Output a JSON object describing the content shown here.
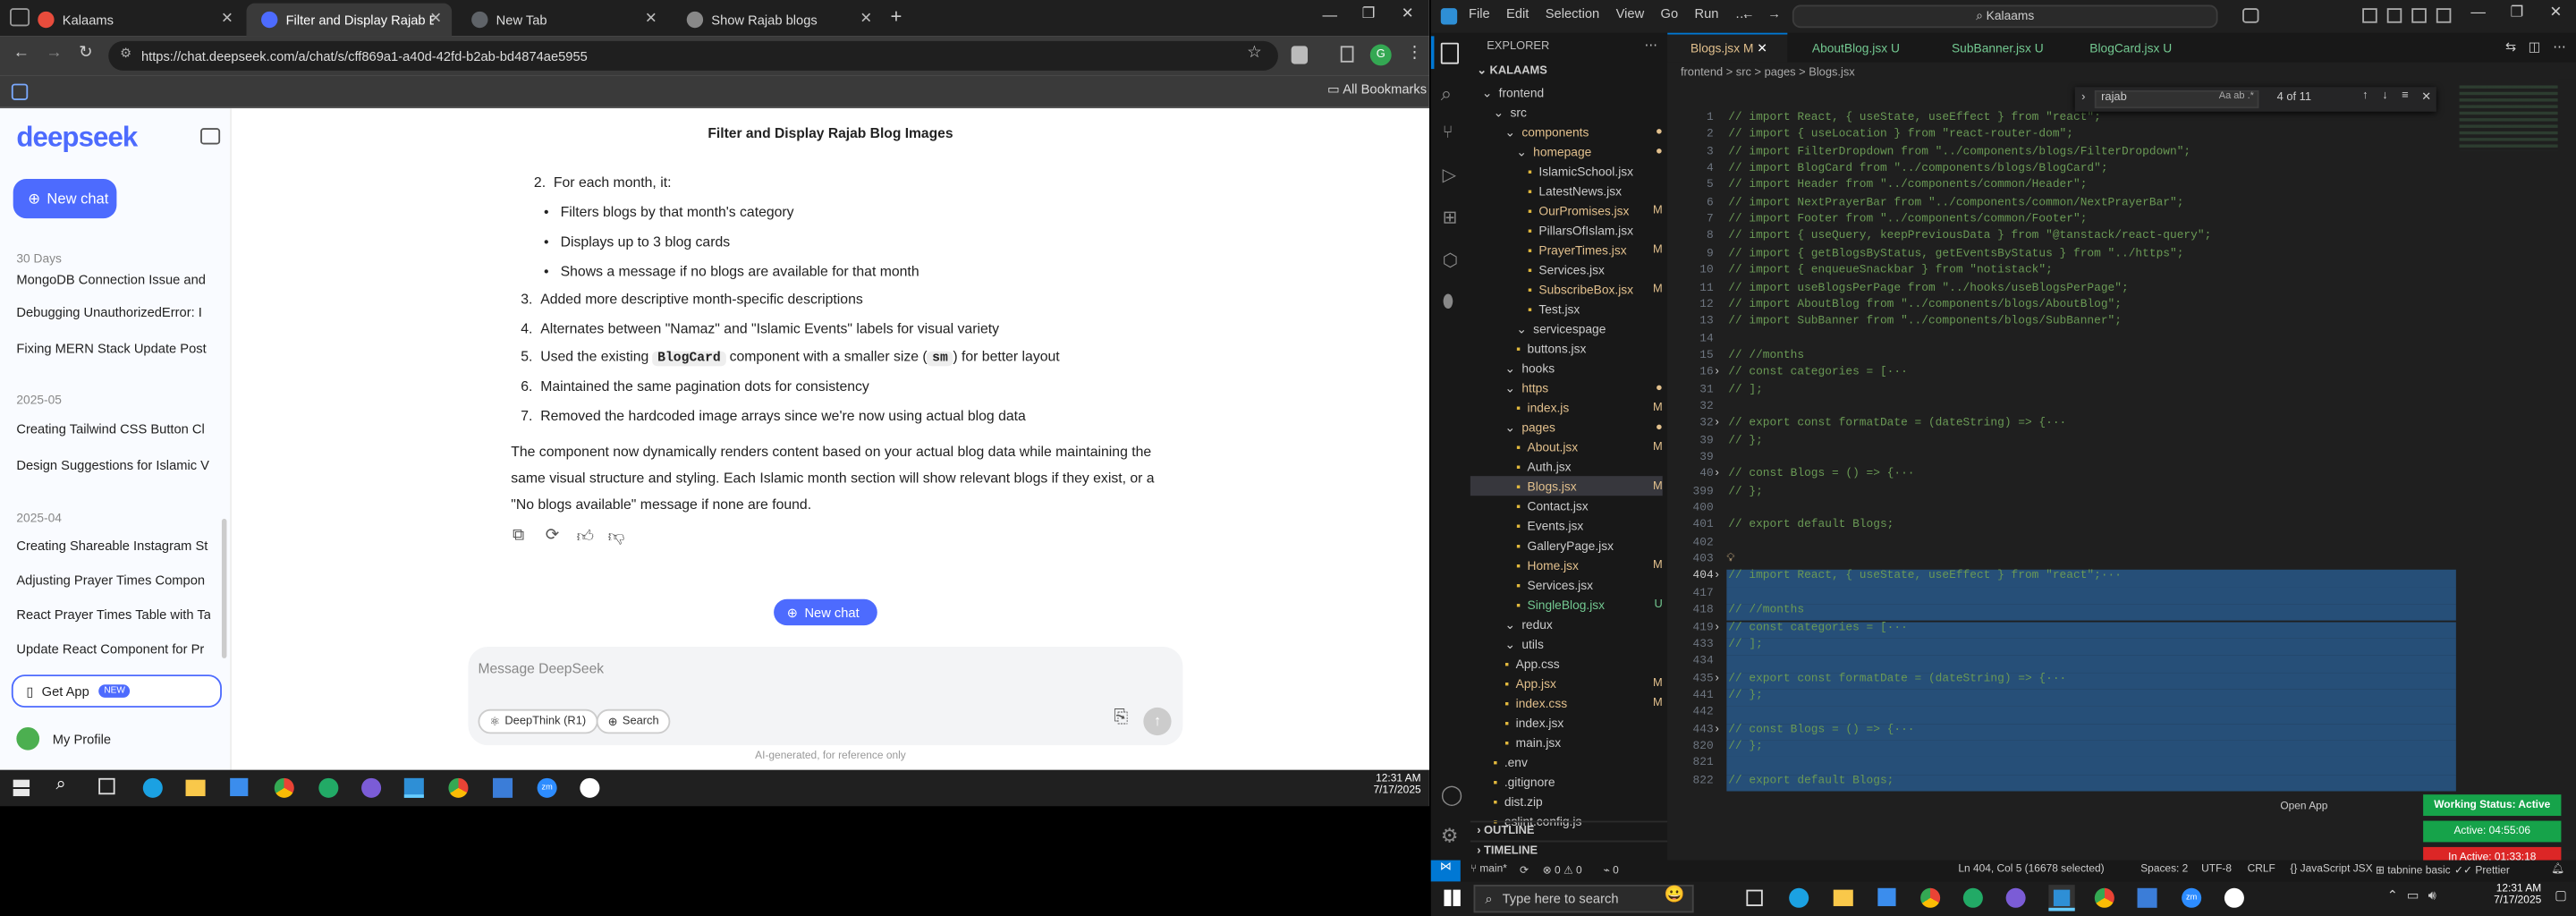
{
  "browser": {
    "tabs": [
      {
        "title": "Kalaams",
        "color": "#e74c3c"
      },
      {
        "title": "Filter and Display Rajab Blog Im",
        "color": "#4d6bfe"
      },
      {
        "title": "New Tab",
        "color": "#5f6368"
      },
      {
        "title": "Show Rajab blogs",
        "color": "#888"
      }
    ],
    "url": "https://chat.deepseek.com/a/chat/s/cff869a1-a40d-42fd-b2ab-bd4874ae5955",
    "all_bookmarks": "All Bookmarks"
  },
  "deepseek": {
    "logo": "deepseek",
    "new_chat": "New chat",
    "sections": [
      {
        "head": "30 Days",
        "items": [
          "MongoDB Connection Issue and",
          "Debugging UnauthorizedError: I",
          "Fixing MERN Stack Update Post I"
        ]
      },
      {
        "head": "2025-05",
        "items": [
          "Creating Tailwind CSS Button Cl",
          "Design Suggestions for Islamic V"
        ]
      },
      {
        "head": "2025-04",
        "items": [
          "Creating Shareable Instagram St",
          "Adjusting Prayer Times Compon",
          "React Prayer Times Table with Ta",
          "Update React Component for Pr"
        ]
      }
    ],
    "get_app": "Get App",
    "new_badge": "NEW",
    "profile": "My Profile",
    "chat_title": "Filter and Display Rajab Blog Images",
    "list": {
      "item2": "For each month, it:",
      "sub1": "Filters blogs by that month's category",
      "sub2": "Displays up to 3 blog cards",
      "sub3": "Shows a message if no blogs are available for that month",
      "item3": "Added more descriptive month-specific descriptions",
      "item4": "Alternates between \"Namaz\" and \"Islamic Events\" labels for visual variety",
      "item5a": "Used the existing",
      "item5code": "BlogCard",
      "item5b": "component with a smaller size (",
      "item5code2": "sm",
      "item5c": ") for better layout",
      "item6": "Maintained the same pagination dots for consistency",
      "item7": "Removed the hardcoded image arrays since we're now using actual blog data"
    },
    "para": [
      "The component now dynamically renders content based on your actual blog data while maintaining the",
      "same visual structure and styling. Each Islamic month section will show relevant blogs if they exist, or a",
      "\"No blogs available\" message if none are found."
    ],
    "new_chat_pill": "New chat",
    "input_placeholder": "Message DeepSeek",
    "deepthink": "DeepThink (R1)",
    "search": "Search",
    "disclaimer": "AI-generated, for reference only"
  },
  "taskbar_left": {
    "time": "12:31 AM",
    "date": "7/17/2025"
  },
  "taskbar_right": {
    "search": "Type here to search",
    "time": "12:31 AM",
    "date": "7/17/2025"
  },
  "vscode": {
    "menu": [
      "File",
      "Edit",
      "Selection",
      "View",
      "Go",
      "Run",
      "…"
    ],
    "search": "Kalaams",
    "tabs": [
      {
        "name": "Blogs.jsx",
        "mark": "M",
        "active": true,
        "color": "#e2c08d"
      },
      {
        "name": "AboutBlog.jsx",
        "mark": "U",
        "active": false,
        "color": "#73c991"
      },
      {
        "name": "SubBanner.jsx",
        "mark": "U",
        "active": false,
        "color": "#73c991"
      },
      {
        "name": "BlogCard.jsx",
        "mark": "U",
        "active": false,
        "color": "#73c991"
      }
    ],
    "breadcrumb": "frontend > src > pages > Blogs.jsx",
    "find": {
      "query": "rajab",
      "count": "4 of 11"
    },
    "explorer_title": "EXPLORER",
    "root": "KALAAMS",
    "tree": [
      {
        "t": "frontend",
        "d": 1,
        "f": true,
        "c": "#ccc"
      },
      {
        "t": "src",
        "d": 2,
        "f": true,
        "c": "#ccc"
      },
      {
        "t": "components",
        "d": 3,
        "f": true,
        "c": "#e2c08d",
        "m": "●"
      },
      {
        "t": "homepage",
        "d": 4,
        "f": true,
        "c": "#e2c08d",
        "m": "●"
      },
      {
        "t": "IslamicSchool.jsx",
        "d": 5,
        "c": "#ccc"
      },
      {
        "t": "LatestNews.jsx",
        "d": 5,
        "c": "#ccc"
      },
      {
        "t": "OurPromises.jsx",
        "d": 5,
        "c": "#e2c08d",
        "m": "M"
      },
      {
        "t": "PillarsOfIslam.jsx",
        "d": 5,
        "c": "#ccc"
      },
      {
        "t": "PrayerTimes.jsx",
        "d": 5,
        "c": "#e2c08d",
        "m": "M"
      },
      {
        "t": "Services.jsx",
        "d": 5,
        "c": "#ccc"
      },
      {
        "t": "SubscribeBox.jsx",
        "d": 5,
        "c": "#e2c08d",
        "m": "M"
      },
      {
        "t": "Test.jsx",
        "d": 5,
        "c": "#ccc"
      },
      {
        "t": "servicespage",
        "d": 4,
        "f": true,
        "c": "#ccc"
      },
      {
        "t": "buttons.jsx",
        "d": 4,
        "c": "#ccc"
      },
      {
        "t": "hooks",
        "d": 3,
        "f": true,
        "c": "#ccc"
      },
      {
        "t": "https",
        "d": 3,
        "f": true,
        "c": "#e2c08d",
        "m": "●"
      },
      {
        "t": "index.js",
        "d": 4,
        "c": "#e2c08d",
        "m": "M"
      },
      {
        "t": "pages",
        "d": 3,
        "f": true,
        "c": "#e2c08d",
        "m": "●"
      },
      {
        "t": "About.jsx",
        "d": 4,
        "c": "#e2c08d",
        "m": "M"
      },
      {
        "t": "Auth.jsx",
        "d": 4,
        "c": "#ccc"
      },
      {
        "t": "Blogs.jsx",
        "d": 4,
        "c": "#e2c08d",
        "m": "M",
        "sel": true
      },
      {
        "t": "Contact.jsx",
        "d": 4,
        "c": "#ccc"
      },
      {
        "t": "Events.jsx",
        "d": 4,
        "c": "#ccc"
      },
      {
        "t": "GalleryPage.jsx",
        "d": 4,
        "c": "#ccc"
      },
      {
        "t": "Home.jsx",
        "d": 4,
        "c": "#e2c08d",
        "m": "M"
      },
      {
        "t": "Services.jsx",
        "d": 4,
        "c": "#ccc"
      },
      {
        "t": "SingleBlog.jsx",
        "d": 4,
        "c": "#73c991",
        "m": "U"
      },
      {
        "t": "redux",
        "d": 3,
        "f": true,
        "c": "#ccc"
      },
      {
        "t": "utils",
        "d": 3,
        "f": true,
        "c": "#ccc"
      },
      {
        "t": "App.css",
        "d": 3,
        "c": "#ccc"
      },
      {
        "t": "App.jsx",
        "d": 3,
        "c": "#e2c08d",
        "m": "M"
      },
      {
        "t": "index.css",
        "d": 3,
        "c": "#e2c08d",
        "m": "M"
      },
      {
        "t": "index.jsx",
        "d": 3,
        "c": "#ccc"
      },
      {
        "t": "main.jsx",
        "d": 3,
        "c": "#ccc"
      },
      {
        "t": ".env",
        "d": 2,
        "c": "#ccc"
      },
      {
        "t": ".gitignore",
        "d": 2,
        "c": "#ccc"
      },
      {
        "t": "dist.zip",
        "d": 2,
        "c": "#ccc"
      },
      {
        "t": "eslint.config.js",
        "d": 2,
        "c": "#ccc"
      }
    ],
    "outline": "OUTLINE",
    "timeline": "TIMELINE",
    "code": [
      {
        "n": "1",
        "t": "// import React, { useState, useEffect } from \"react\";"
      },
      {
        "n": "2",
        "t": "// import { useLocation } from \"react-router-dom\";"
      },
      {
        "n": "3",
        "t": "// import FilterDropdown from \"../components/blogs/FilterDropdown\";"
      },
      {
        "n": "4",
        "t": "// import BlogCard from \"../components/blogs/BlogCard\";"
      },
      {
        "n": "5",
        "t": "// import Header from \"../components/common/Header\";"
      },
      {
        "n": "6",
        "t": "// import NextPrayerBar from \"../components/common/NextPrayerBar\";"
      },
      {
        "n": "7",
        "t": "// import Footer from \"../components/common/Footer\";"
      },
      {
        "n": "8",
        "t": "// import { useQuery, keepPreviousData } from \"@tanstack/react-query\";"
      },
      {
        "n": "9",
        "t": "// import { getBlogsByStatus, getEventsByStatus } from \"../https\";"
      },
      {
        "n": "10",
        "t": "// import { enqueueSnackbar } from \"notistack\";"
      },
      {
        "n": "11",
        "t": "// import useBlogsPerPage from \"../hooks/useBlogsPerPage\";"
      },
      {
        "n": "12",
        "t": "// import AboutBlog from \"../components/blogs/AboutBlog\";"
      },
      {
        "n": "13",
        "t": "// import SubBanner from \"../components/blogs/SubBanner\";"
      },
      {
        "n": "14",
        "t": ""
      },
      {
        "n": "15",
        "t": "// //months"
      },
      {
        "n": "16",
        "t": "// const categories = [···",
        "fold": true
      },
      {
        "n": "31",
        "t": "// ];"
      },
      {
        "n": "32",
        "t": ""
      },
      {
        "n": "32",
        "t": "// export const formatDate = (dateString) => {···",
        "fold": true
      },
      {
        "n": "39",
        "t": "// };"
      },
      {
        "n": "39",
        "t": ""
      },
      {
        "n": "40",
        "t": "// const Blogs = () => {···",
        "fold": true
      },
      {
        "n": "399",
        "t": "// };"
      },
      {
        "n": "400",
        "t": ""
      },
      {
        "n": "401",
        "t": "// export default Blogs;"
      },
      {
        "n": "402",
        "t": ""
      },
      {
        "n": "403",
        "t": ""
      },
      {
        "n": "404",
        "t": "// import React, { useState, useEffect } from \"react\";···",
        "fold": true,
        "sel": true,
        "cur": true
      },
      {
        "n": "417",
        "t": "",
        "sel": true
      },
      {
        "n": "418",
        "t": "// //months",
        "sel": true
      },
      {
        "n": "419",
        "t": "// const categories = [···",
        "fold": true,
        "sel": true
      },
      {
        "n": "433",
        "t": "// ];",
        "sel": true
      },
      {
        "n": "434",
        "t": "",
        "sel": true
      },
      {
        "n": "435",
        "t": "// export const formatDate = (dateString) => {···",
        "fold": true,
        "sel": true
      },
      {
        "n": "441",
        "t": "// };",
        "sel": true
      },
      {
        "n": "442",
        "t": "",
        "sel": true
      },
      {
        "n": "443",
        "t": "// const Blogs = () => {···",
        "fold": true,
        "sel": true
      },
      {
        "n": "820",
        "t": "// };",
        "sel": true
      },
      {
        "n": "821",
        "t": "",
        "sel": true
      },
      {
        "n": "822",
        "t": "// export default Blogs;",
        "sel": true
      }
    ],
    "open_app": "Open App",
    "working_status": "Working Status: Active",
    "active_time": "Active: 04:55:06",
    "inactive_time": "In Active: 01:33:18",
    "status": {
      "branch": "main*",
      "problems": "⊗ 0 ⚠ 0",
      "ports": "⌁ 0",
      "cursor": "Ln 404, Col 5 (16678 selected)",
      "spaces": "Spaces: 2",
      "enc": "UTF-8",
      "eol": "CRLF",
      "lang": "{} JavaScript JSX",
      "tabnine": "tabnine basic",
      "prettier": "Prettier"
    }
  }
}
